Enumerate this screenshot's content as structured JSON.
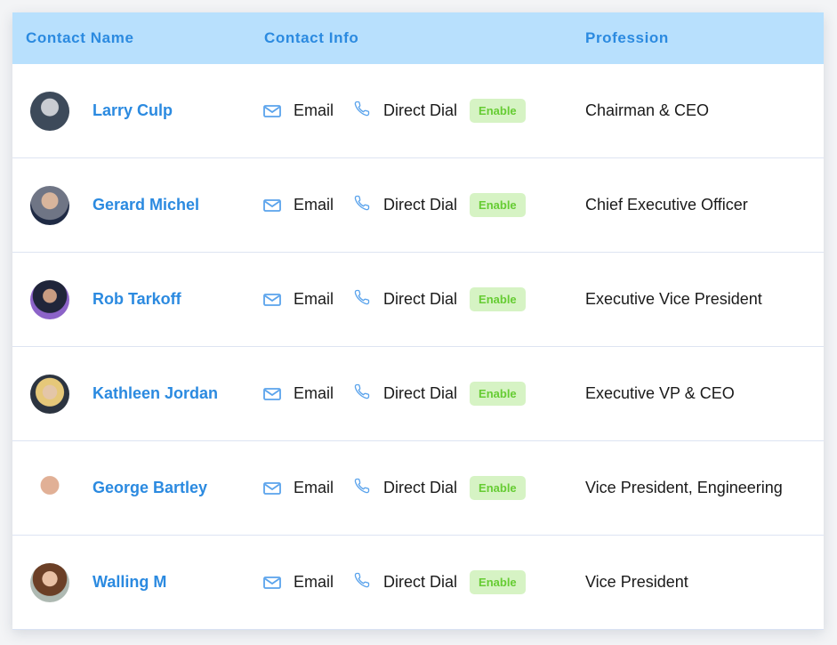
{
  "header": {
    "col_name": "Contact Name",
    "col_info": "Contact Info",
    "col_profession": "Profession"
  },
  "contact_labels": {
    "email": "Email",
    "direct_dial": "Direct Dial",
    "enable": "Enable"
  },
  "colors": {
    "accent": "#2b8ae0",
    "header_bg": "#b8e0fd",
    "badge_bg": "#d6f3c4",
    "badge_text": "#66cc33"
  },
  "contacts": [
    {
      "name": "Larry Culp",
      "profession": "Chairman & CEO",
      "avatar": "avatar-photo"
    },
    {
      "name": "Gerard Michel",
      "profession": "Chief Executive Officer",
      "avatar": "avatar-photo"
    },
    {
      "name": "Rob Tarkoff",
      "profession": "Executive Vice President",
      "avatar": "avatar-photo"
    },
    {
      "name": "Kathleen Jordan",
      "profession": "Executive VP & CEO",
      "avatar": "avatar-photo"
    },
    {
      "name": "George Bartley",
      "profession": "Vice President, Engineering",
      "avatar": "avatar-photo"
    },
    {
      "name": "Walling M",
      "profession": "Vice President",
      "avatar": "avatar-photo"
    }
  ]
}
